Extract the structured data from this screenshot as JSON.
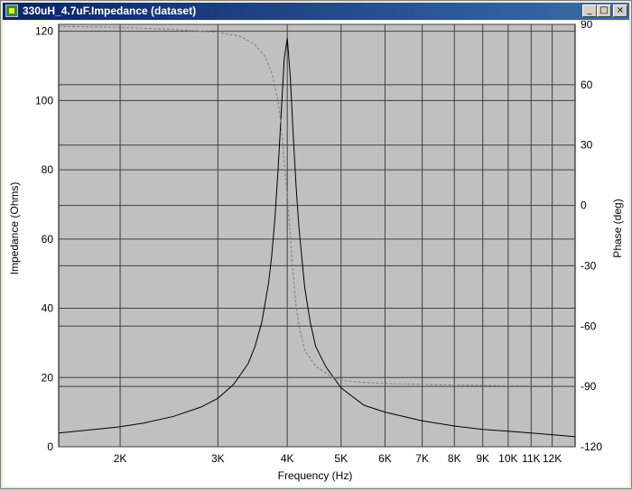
{
  "window": {
    "title": "330uH_4.7uF.Impedance (dataset)",
    "min_glyph": "_",
    "max_glyph": "□",
    "close_glyph": "×"
  },
  "colors": {
    "plot_bg": "#c0c0c0",
    "grid": "#404040",
    "impedance_line": "#000000",
    "phase_line": "#808080"
  },
  "chart_data": {
    "type": "line",
    "xlabel": "Frequency (Hz)",
    "ylabel": "Impedance (Ohms)",
    "y2label": "Phase (deg)",
    "xscale": "log",
    "xlim": [
      1550,
      13200
    ],
    "ylim": [
      0,
      122
    ],
    "y2lim": [
      -120,
      90
    ],
    "grid": true,
    "x_ticks": [
      {
        "value": 2000,
        "label": "2K"
      },
      {
        "value": 3000,
        "label": "3K"
      },
      {
        "value": 4000,
        "label": "4K"
      },
      {
        "value": 5000,
        "label": "5K"
      },
      {
        "value": 6000,
        "label": "6K"
      },
      {
        "value": 7000,
        "label": "7K"
      },
      {
        "value": 8000,
        "label": "8K"
      },
      {
        "value": 9000,
        "label": "9K"
      },
      {
        "value": 10000,
        "label": "10K"
      },
      {
        "value": 11000,
        "label": "11K"
      },
      {
        "value": 12000,
        "label": "12K"
      }
    ],
    "y_ticks": [
      {
        "value": 0,
        "label": "0"
      },
      {
        "value": 20,
        "label": "20"
      },
      {
        "value": 40,
        "label": "40"
      },
      {
        "value": 60,
        "label": "60"
      },
      {
        "value": 80,
        "label": "80"
      },
      {
        "value": 100,
        "label": "100"
      },
      {
        "value": 120,
        "label": "120"
      }
    ],
    "y2_ticks": [
      {
        "value": 90,
        "label": "90"
      },
      {
        "value": 60,
        "label": "60"
      },
      {
        "value": 30,
        "label": "30"
      },
      {
        "value": 0,
        "label": "0"
      },
      {
        "value": -30,
        "label": "-30"
      },
      {
        "value": -60,
        "label": "-60"
      },
      {
        "value": -90,
        "label": "-90"
      },
      {
        "value": -120,
        "label": "-120"
      }
    ],
    "series": [
      {
        "axis": "left",
        "style": "solid",
        "x": [
          1550,
          1800,
          2000,
          2200,
          2500,
          2800,
          3000,
          3200,
          3400,
          3500,
          3600,
          3700,
          3750,
          3800,
          3850,
          3900,
          3950,
          4000,
          4050,
          4100,
          4150,
          4200,
          4300,
          4400,
          4500,
          4700,
          5000,
          5500,
          6000,
          7000,
          8000,
          9000,
          10000,
          11000,
          12000,
          13200
        ],
        "values": [
          4,
          5,
          5.8,
          6.8,
          8.8,
          11.5,
          14,
          18,
          24,
          29,
          36,
          47,
          55,
          66,
          80,
          96,
          112,
          118,
          107,
          90,
          75,
          63,
          46,
          36,
          29,
          23,
          17,
          12,
          10,
          7.5,
          6,
          5,
          4.5,
          4,
          3.5,
          2.9
        ]
      },
      {
        "axis": "right",
        "style": "dashed",
        "x": [
          1550,
          2000,
          2500,
          3000,
          3300,
          3500,
          3650,
          3750,
          3850,
          3900,
          3950,
          4000,
          4050,
          4100,
          4150,
          4200,
          4300,
          4500,
          4800,
          5000,
          5500,
          6000,
          7000,
          8000,
          10000,
          13200
        ],
        "values": [
          89,
          88.5,
          87.5,
          86,
          84,
          80,
          74,
          66,
          52,
          40,
          22,
          5,
          -15,
          -35,
          -50,
          -60,
          -72,
          -80,
          -85,
          -87,
          -88,
          -88.5,
          -89,
          -89.3,
          -89.6,
          -89.8
        ]
      }
    ]
  }
}
